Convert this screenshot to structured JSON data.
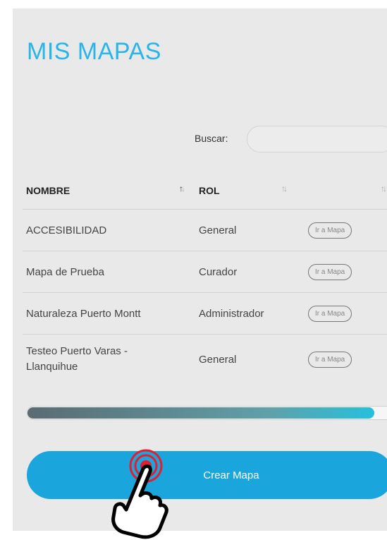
{
  "page": {
    "title": "MIS MAPAS",
    "search_label": "Buscar:",
    "search_value": ""
  },
  "table": {
    "headers": {
      "name": "NOMBRE",
      "role": "ROL",
      "action": ""
    },
    "rows": [
      {
        "name": "ACCESIBILIDAD",
        "role": "General",
        "action": "Ir a Mapa"
      },
      {
        "name": "Mapa de Prueba",
        "role": "Curador",
        "action": "Ir a Mapa"
      },
      {
        "name": "Naturaleza Puerto Montt",
        "role": "Administrador",
        "action": "Ir a Mapa"
      },
      {
        "name": "Testeo Puerto Varas - Llanquihue",
        "role": "General",
        "action": "Ir a Mapa"
      }
    ]
  },
  "scrollbar": {
    "position_fraction": 0.95
  },
  "actions": {
    "create_label": "Crear Mapa"
  },
  "colors": {
    "accent": "#29b5e8",
    "create_button": "#1aa6dc",
    "tap_ring": "#e02030"
  },
  "icons": {
    "sort": "sort-arrows-icon",
    "pointer": "hand-pointer-icon"
  }
}
